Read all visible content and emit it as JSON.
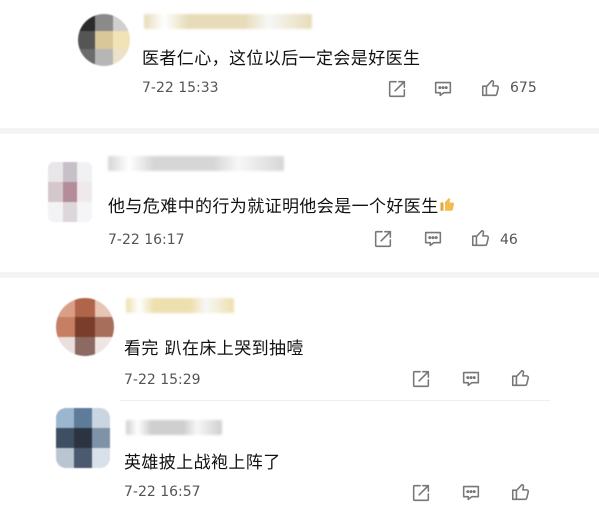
{
  "comments": [
    {
      "text": "医者仁心，这位以后一定会是好医生",
      "time": "7-22 15:33",
      "likes": "675",
      "avatar_colors": [
        "#2b2b2b",
        "#8a8a8a",
        "#cfcfcf",
        "#555555",
        "#d9c79a",
        "#f1e3b5",
        "#6b6b6b",
        "#b6b6b6",
        "#ece2c9"
      ],
      "name_color": "#e7dcb8"
    },
    {
      "text": "他与危难中的行为就证明他会是一个好医生",
      "time": "7-22 16:17",
      "likes": "46",
      "avatar_colors": [
        "#e8e6e8",
        "#c7c0c8",
        "#f1f0f2",
        "#d5c8cc",
        "#b58c9a",
        "#efe9ec",
        "#f3f2f4",
        "#ddd6da",
        "#f5f4f6"
      ],
      "name_color": "#d6d6d6"
    },
    {
      "text": "看完 趴在床上哭到抽噎",
      "time": "7-22 15:29",
      "likes": "",
      "avatar_colors": [
        "#d89e86",
        "#b0654b",
        "#e7c4b3",
        "#c57f63",
        "#7a3d2c",
        "#a76e5c",
        "#e9dfdc",
        "#8c6a62",
        "#efe6e3"
      ],
      "name_color": "#eedfae"
    },
    {
      "text": "英雄披上战袍上阵了",
      "time": "7-22 16:57",
      "likes": "",
      "avatar_colors": [
        "#9bb6cf",
        "#5e7c9a",
        "#c9d6e2",
        "#3e4f63",
        "#2c3442",
        "#7e93a8",
        "#b9c6d2",
        "#4b5a6e",
        "#d8e0e8"
      ],
      "name_color": "#cfcfcf"
    }
  ],
  "icons": {
    "share": "share-icon",
    "comment": "comment-icon",
    "like": "thumbs-up-icon"
  }
}
